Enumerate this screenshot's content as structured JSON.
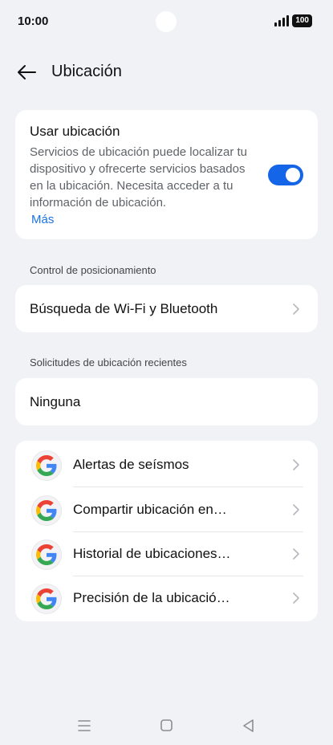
{
  "status_bar": {
    "time": "10:00",
    "battery": "100"
  },
  "header": {
    "title": "Ubicación"
  },
  "location_card": {
    "title": "Usar ubicación",
    "description": "Servicios de ubicación puede localizar tu dispositivo y ofrecerte servicios basados en la ubicación. Necesita acceder a tu información de ubicación.",
    "more_link": "Más",
    "toggle_on": true
  },
  "positioning": {
    "section_label": "Control de posicionamiento",
    "item_label": "Búsqueda de Wi-Fi y Bluetooth"
  },
  "recent_requests": {
    "section_label": "Solicitudes de ubicación recientes",
    "value": "Ninguna"
  },
  "services": [
    {
      "label": "Alertas de seísmos",
      "icon": "google-icon"
    },
    {
      "label": "Compartir ubicación en…",
      "icon": "google-icon"
    },
    {
      "label": "Historial de ubicaciones…",
      "icon": "google-icon"
    },
    {
      "label": "Precisión de la ubicació…",
      "icon": "google-icon"
    }
  ],
  "colors": {
    "accent": "#1565e8",
    "link": "#1a73e8",
    "background": "#f1f2f6"
  }
}
